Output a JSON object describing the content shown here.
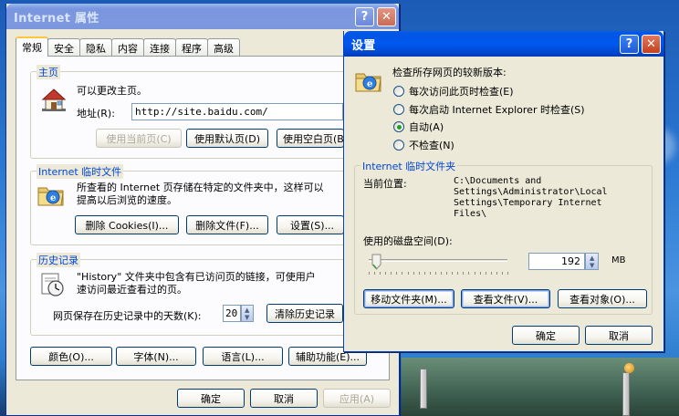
{
  "colors": {
    "accent_blue": "#0046d5",
    "title_active": "#0055e5",
    "title_inactive": "#7d98de",
    "dialog_bg": "#ece9d8"
  },
  "props_window": {
    "title": "Internet 属性",
    "help": "?",
    "close": "✕",
    "tabs": [
      "常规",
      "安全",
      "隐私",
      "内容",
      "连接",
      "程序",
      "高级"
    ],
    "home": {
      "label": "主页",
      "desc": "可以更改主页。",
      "address_label": "地址(R):",
      "address_value": "http://site.baidu.com/",
      "btn_current": "使用当前页(C)",
      "btn_default": "使用默认页(D)",
      "btn_blank": "使用空白页(B)"
    },
    "temp": {
      "label": "Internet 临时文件",
      "desc_line1": "所查看的 Internet 页存储在特定的文件夹中，这样可以",
      "desc_line2": "提高以后浏览的速度。",
      "btn_cookies": "删除 Cookies(I)...",
      "btn_files": "删除文件(F)...",
      "btn_settings": "设置(S)..."
    },
    "history": {
      "label": "历史记录",
      "desc_line1": "\"History\" 文件夹中包含有已访问页的链接，可使用户",
      "desc_line2": "速访问最近查看过的页。",
      "days_label": "网页保存在历史记录中的天数(K):",
      "days_value": "20",
      "btn_clear": "清除历史记录"
    },
    "bottom": {
      "btn_colors": "颜色(O)...",
      "btn_fonts": "字体(N)...",
      "btn_lang": "语言(L)...",
      "btn_access": "辅助功能(E)..."
    },
    "ok": "确定",
    "cancel": "取消",
    "apply": "应用(A)"
  },
  "settings_window": {
    "title": "设置",
    "help": "?",
    "close": "✕",
    "check_label": "检查所存网页的较新版本:",
    "options": [
      {
        "label": "每次访问此页时检查(E)",
        "checked": false
      },
      {
        "label": "每次启动 Internet Explorer 时检查(S)",
        "checked": false
      },
      {
        "label": "自动(A)",
        "checked": true
      },
      {
        "label": "不检查(N)",
        "checked": false
      }
    ],
    "temp_group": "Internet 临时文件夹",
    "location_label": "当前位置:",
    "location_lines": [
      "C:\\Documents and",
      "Settings\\Administrator\\Local",
      "Settings\\Temporary Internet",
      "Files\\"
    ],
    "disk_label": "使用的磁盘空间(D):",
    "disk_value": "192",
    "disk_unit": "MB",
    "slider_fraction": 0.02,
    "btn_move": "移动文件夹(M)...",
    "btn_view_files": "查看文件(V)...",
    "btn_view_objects": "查看对象(O)...",
    "ok": "确定",
    "cancel": "取消"
  }
}
